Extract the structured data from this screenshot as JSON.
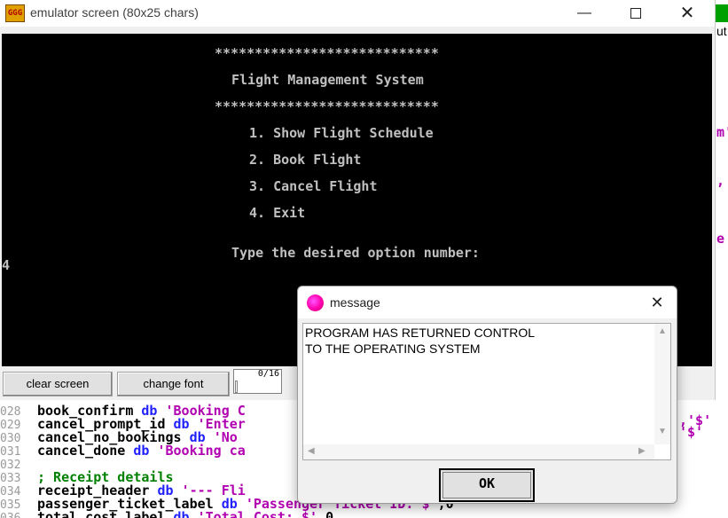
{
  "emulator": {
    "title": "emulator screen (80x25 chars)",
    "icon_text": "GGG",
    "screen_lines": [
      "****************************",
      "Flight Management System",
      "****************************",
      "1. Show Flight Schedule",
      "2. Book Flight",
      "3. Cancel Flight",
      "4. Exit",
      "Type the desired option number:",
      "4"
    ],
    "clear_label": "clear screen",
    "font_label": "change font",
    "progress_text": "0/16",
    "colors": {
      "screen_bg": "#000000",
      "screen_text": "#c0c0c0"
    }
  },
  "editor": {
    "lines": [
      {
        "num": "028",
        "parts": [
          {
            "t": "book_confirm ",
            "c": "ident"
          },
          {
            "t": "db ",
            "c": "kw"
          },
          {
            "t": "'Booking C",
            "c": "str"
          }
        ]
      },
      {
        "num": "029",
        "parts": [
          {
            "t": "cancel_prompt_id ",
            "c": "ident"
          },
          {
            "t": "db ",
            "c": "kw"
          },
          {
            "t": "'Enter",
            "c": "str"
          }
        ]
      },
      {
        "num": "030",
        "parts": [
          {
            "t": "cancel_no_bookings ",
            "c": "ident"
          },
          {
            "t": "db ",
            "c": "kw"
          },
          {
            "t": "'No ",
            "c": "str"
          }
        ]
      },
      {
        "num": "031",
        "parts": [
          {
            "t": "cancel_done ",
            "c": "ident"
          },
          {
            "t": "db ",
            "c": "kw"
          },
          {
            "t": "'Booking ca",
            "c": "str"
          }
        ]
      },
      {
        "num": "032",
        "parts": []
      },
      {
        "num": "033",
        "parts": [
          {
            "t": "; Receipt details",
            "c": "cmt"
          }
        ]
      },
      {
        "num": "034",
        "parts": [
          {
            "t": "receipt_header ",
            "c": "ident"
          },
          {
            "t": "db ",
            "c": "kw"
          },
          {
            "t": "'--- Fli",
            "c": "str"
          }
        ]
      },
      {
        "num": "035",
        "parts": [
          {
            "t": "passenger_ticket_label ",
            "c": "ident"
          },
          {
            "t": "db ",
            "c": "kw"
          },
          {
            "t": "'Passenger Ticket ID: $'",
            "c": "str"
          },
          {
            "t": ",0",
            "c": "num"
          }
        ]
      },
      {
        "num": "036",
        "parts": [
          {
            "t": "total_cost_label ",
            "c": "ident"
          },
          {
            "t": "db ",
            "c": "kw"
          },
          {
            "t": "'Total Cost: $'",
            "c": "str"
          },
          {
            "t": ",0",
            "c": "num"
          }
        ]
      }
    ],
    "right_fragments": [
      ",'$'",
      "'$'"
    ]
  },
  "dialog": {
    "title": "message",
    "message_lines": [
      "PROGRAM HAS RETURNED CONTROL",
      "TO THE OPERATING SYSTEM"
    ],
    "ok_label": "OK"
  }
}
